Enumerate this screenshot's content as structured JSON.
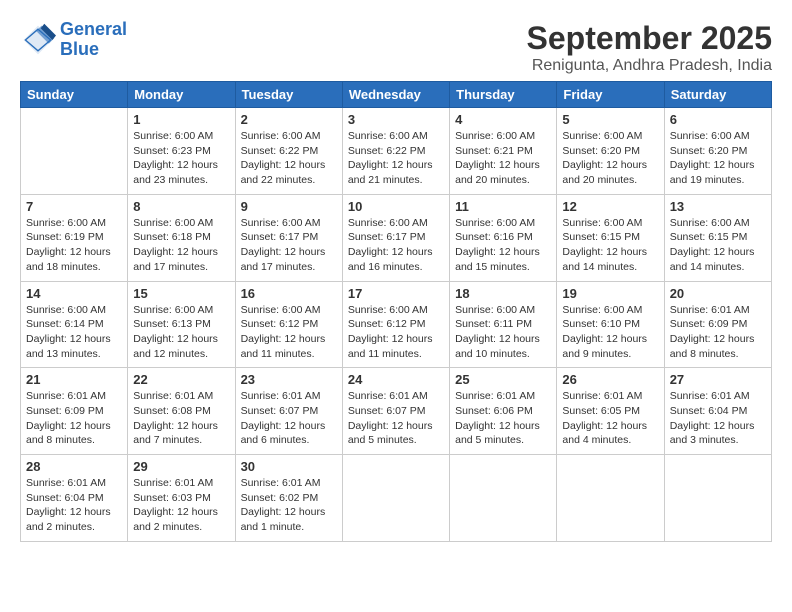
{
  "header": {
    "logo_line1": "General",
    "logo_line2": "Blue",
    "title": "September 2025",
    "subtitle": "Renigunta, Andhra Pradesh, India"
  },
  "weekdays": [
    "Sunday",
    "Monday",
    "Tuesday",
    "Wednesday",
    "Thursday",
    "Friday",
    "Saturday"
  ],
  "weeks": [
    [
      {
        "day": "",
        "info": ""
      },
      {
        "day": "1",
        "info": "Sunrise: 6:00 AM\nSunset: 6:23 PM\nDaylight: 12 hours\nand 23 minutes."
      },
      {
        "day": "2",
        "info": "Sunrise: 6:00 AM\nSunset: 6:22 PM\nDaylight: 12 hours\nand 22 minutes."
      },
      {
        "day": "3",
        "info": "Sunrise: 6:00 AM\nSunset: 6:22 PM\nDaylight: 12 hours\nand 21 minutes."
      },
      {
        "day": "4",
        "info": "Sunrise: 6:00 AM\nSunset: 6:21 PM\nDaylight: 12 hours\nand 20 minutes."
      },
      {
        "day": "5",
        "info": "Sunrise: 6:00 AM\nSunset: 6:20 PM\nDaylight: 12 hours\nand 20 minutes."
      },
      {
        "day": "6",
        "info": "Sunrise: 6:00 AM\nSunset: 6:20 PM\nDaylight: 12 hours\nand 19 minutes."
      }
    ],
    [
      {
        "day": "7",
        "info": "Sunrise: 6:00 AM\nSunset: 6:19 PM\nDaylight: 12 hours\nand 18 minutes."
      },
      {
        "day": "8",
        "info": "Sunrise: 6:00 AM\nSunset: 6:18 PM\nDaylight: 12 hours\nand 17 minutes."
      },
      {
        "day": "9",
        "info": "Sunrise: 6:00 AM\nSunset: 6:17 PM\nDaylight: 12 hours\nand 17 minutes."
      },
      {
        "day": "10",
        "info": "Sunrise: 6:00 AM\nSunset: 6:17 PM\nDaylight: 12 hours\nand 16 minutes."
      },
      {
        "day": "11",
        "info": "Sunrise: 6:00 AM\nSunset: 6:16 PM\nDaylight: 12 hours\nand 15 minutes."
      },
      {
        "day": "12",
        "info": "Sunrise: 6:00 AM\nSunset: 6:15 PM\nDaylight: 12 hours\nand 14 minutes."
      },
      {
        "day": "13",
        "info": "Sunrise: 6:00 AM\nSunset: 6:15 PM\nDaylight: 12 hours\nand 14 minutes."
      }
    ],
    [
      {
        "day": "14",
        "info": "Sunrise: 6:00 AM\nSunset: 6:14 PM\nDaylight: 12 hours\nand 13 minutes."
      },
      {
        "day": "15",
        "info": "Sunrise: 6:00 AM\nSunset: 6:13 PM\nDaylight: 12 hours\nand 12 minutes."
      },
      {
        "day": "16",
        "info": "Sunrise: 6:00 AM\nSunset: 6:12 PM\nDaylight: 12 hours\nand 11 minutes."
      },
      {
        "day": "17",
        "info": "Sunrise: 6:00 AM\nSunset: 6:12 PM\nDaylight: 12 hours\nand 11 minutes."
      },
      {
        "day": "18",
        "info": "Sunrise: 6:00 AM\nSunset: 6:11 PM\nDaylight: 12 hours\nand 10 minutes."
      },
      {
        "day": "19",
        "info": "Sunrise: 6:00 AM\nSunset: 6:10 PM\nDaylight: 12 hours\nand 9 minutes."
      },
      {
        "day": "20",
        "info": "Sunrise: 6:01 AM\nSunset: 6:09 PM\nDaylight: 12 hours\nand 8 minutes."
      }
    ],
    [
      {
        "day": "21",
        "info": "Sunrise: 6:01 AM\nSunset: 6:09 PM\nDaylight: 12 hours\nand 8 minutes."
      },
      {
        "day": "22",
        "info": "Sunrise: 6:01 AM\nSunset: 6:08 PM\nDaylight: 12 hours\nand 7 minutes."
      },
      {
        "day": "23",
        "info": "Sunrise: 6:01 AM\nSunset: 6:07 PM\nDaylight: 12 hours\nand 6 minutes."
      },
      {
        "day": "24",
        "info": "Sunrise: 6:01 AM\nSunset: 6:07 PM\nDaylight: 12 hours\nand 5 minutes."
      },
      {
        "day": "25",
        "info": "Sunrise: 6:01 AM\nSunset: 6:06 PM\nDaylight: 12 hours\nand 5 minutes."
      },
      {
        "day": "26",
        "info": "Sunrise: 6:01 AM\nSunset: 6:05 PM\nDaylight: 12 hours\nand 4 minutes."
      },
      {
        "day": "27",
        "info": "Sunrise: 6:01 AM\nSunset: 6:04 PM\nDaylight: 12 hours\nand 3 minutes."
      }
    ],
    [
      {
        "day": "28",
        "info": "Sunrise: 6:01 AM\nSunset: 6:04 PM\nDaylight: 12 hours\nand 2 minutes."
      },
      {
        "day": "29",
        "info": "Sunrise: 6:01 AM\nSunset: 6:03 PM\nDaylight: 12 hours\nand 2 minutes."
      },
      {
        "day": "30",
        "info": "Sunrise: 6:01 AM\nSunset: 6:02 PM\nDaylight: 12 hours\nand 1 minute."
      },
      {
        "day": "",
        "info": ""
      },
      {
        "day": "",
        "info": ""
      },
      {
        "day": "",
        "info": ""
      },
      {
        "day": "",
        "info": ""
      }
    ]
  ]
}
